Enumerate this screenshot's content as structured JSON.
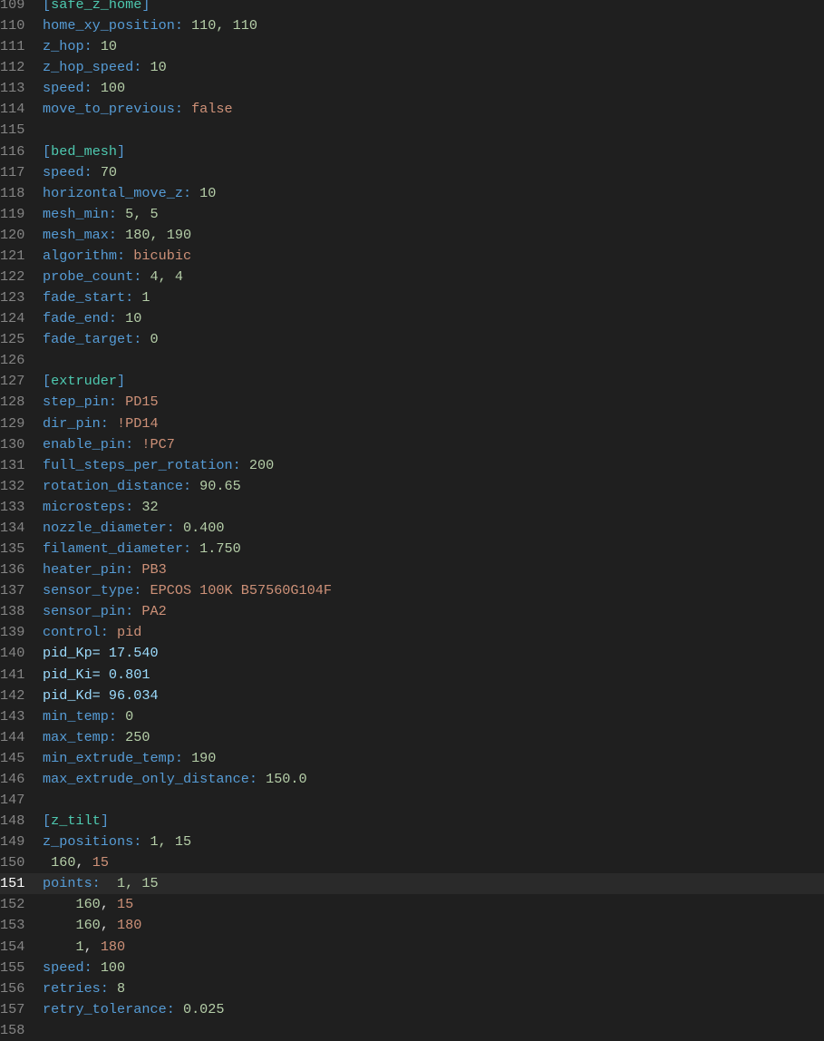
{
  "editor": {
    "current_line": 151,
    "lines": [
      {
        "n": 109,
        "tokens": [
          {
            "t": "[",
            "c": "b"
          },
          {
            "t": "safe_z_home",
            "c": "sec"
          },
          {
            "t": "]",
            "c": "b"
          }
        ]
      },
      {
        "n": 110,
        "tokens": [
          {
            "t": "home_xy_position: ",
            "c": "k"
          },
          {
            "t": "110, 110",
            "c": "n"
          }
        ]
      },
      {
        "n": 111,
        "tokens": [
          {
            "t": "z_hop: ",
            "c": "k"
          },
          {
            "t": "10",
            "c": "n"
          }
        ]
      },
      {
        "n": 112,
        "tokens": [
          {
            "t": "z_hop_speed: ",
            "c": "k"
          },
          {
            "t": "10",
            "c": "n"
          }
        ]
      },
      {
        "n": 113,
        "tokens": [
          {
            "t": "speed: ",
            "c": "k"
          },
          {
            "t": "100",
            "c": "n"
          }
        ]
      },
      {
        "n": 114,
        "tokens": [
          {
            "t": "move_to_previous: ",
            "c": "k"
          },
          {
            "t": "false",
            "c": "s"
          }
        ]
      },
      {
        "n": 115,
        "tokens": []
      },
      {
        "n": 116,
        "tokens": [
          {
            "t": "[",
            "c": "b"
          },
          {
            "t": "bed_mesh",
            "c": "sec"
          },
          {
            "t": "]",
            "c": "b"
          }
        ]
      },
      {
        "n": 117,
        "tokens": [
          {
            "t": "speed: ",
            "c": "k"
          },
          {
            "t": "70",
            "c": "n"
          }
        ]
      },
      {
        "n": 118,
        "tokens": [
          {
            "t": "horizontal_move_z: ",
            "c": "k"
          },
          {
            "t": "10",
            "c": "n"
          }
        ]
      },
      {
        "n": 119,
        "tokens": [
          {
            "t": "mesh_min: ",
            "c": "k"
          },
          {
            "t": "5, 5",
            "c": "n"
          }
        ]
      },
      {
        "n": 120,
        "tokens": [
          {
            "t": "mesh_max: ",
            "c": "k"
          },
          {
            "t": "180, 190",
            "c": "n"
          }
        ]
      },
      {
        "n": 121,
        "tokens": [
          {
            "t": "algorithm: ",
            "c": "k"
          },
          {
            "t": "bicubic",
            "c": "s"
          }
        ]
      },
      {
        "n": 122,
        "tokens": [
          {
            "t": "probe_count: ",
            "c": "k"
          },
          {
            "t": "4, 4",
            "c": "n"
          }
        ]
      },
      {
        "n": 123,
        "tokens": [
          {
            "t": "fade_start: ",
            "c": "k"
          },
          {
            "t": "1",
            "c": "n"
          }
        ]
      },
      {
        "n": 124,
        "tokens": [
          {
            "t": "fade_end: ",
            "c": "k"
          },
          {
            "t": "10",
            "c": "n"
          }
        ]
      },
      {
        "n": 125,
        "tokens": [
          {
            "t": "fade_target: ",
            "c": "k"
          },
          {
            "t": "0",
            "c": "n"
          }
        ]
      },
      {
        "n": 126,
        "tokens": []
      },
      {
        "n": 127,
        "tokens": [
          {
            "t": "[",
            "c": "b"
          },
          {
            "t": "extruder",
            "c": "sec"
          },
          {
            "t": "]",
            "c": "b"
          }
        ]
      },
      {
        "n": 128,
        "tokens": [
          {
            "t": "step_pin: ",
            "c": "k"
          },
          {
            "t": "PD15",
            "c": "s"
          }
        ]
      },
      {
        "n": 129,
        "tokens": [
          {
            "t": "dir_pin: ",
            "c": "k"
          },
          {
            "t": "!PD14",
            "c": "s"
          }
        ]
      },
      {
        "n": 130,
        "tokens": [
          {
            "t": "enable_pin: ",
            "c": "k"
          },
          {
            "t": "!PC7",
            "c": "s"
          }
        ]
      },
      {
        "n": 131,
        "tokens": [
          {
            "t": "full_steps_per_rotation: ",
            "c": "k"
          },
          {
            "t": "200",
            "c": "n"
          }
        ]
      },
      {
        "n": 132,
        "tokens": [
          {
            "t": "rotation_distance: ",
            "c": "k"
          },
          {
            "t": "90.65",
            "c": "n"
          }
        ]
      },
      {
        "n": 133,
        "tokens": [
          {
            "t": "microsteps: ",
            "c": "k"
          },
          {
            "t": "32",
            "c": "n"
          }
        ]
      },
      {
        "n": 134,
        "tokens": [
          {
            "t": "nozzle_diameter: ",
            "c": "k"
          },
          {
            "t": "0.400",
            "c": "n"
          }
        ]
      },
      {
        "n": 135,
        "tokens": [
          {
            "t": "filament_diameter: ",
            "c": "k"
          },
          {
            "t": "1.750",
            "c": "n"
          }
        ]
      },
      {
        "n": 136,
        "tokens": [
          {
            "t": "heater_pin: ",
            "c": "k"
          },
          {
            "t": "PB3",
            "c": "s"
          }
        ]
      },
      {
        "n": 137,
        "tokens": [
          {
            "t": "sensor_type: ",
            "c": "k"
          },
          {
            "t": "EPCOS 100K B57560G104F",
            "c": "s"
          }
        ]
      },
      {
        "n": 138,
        "tokens": [
          {
            "t": "sensor_pin: ",
            "c": "k"
          },
          {
            "t": "PA2",
            "c": "s"
          }
        ]
      },
      {
        "n": 139,
        "tokens": [
          {
            "t": "control: ",
            "c": "k"
          },
          {
            "t": "pid",
            "c": "s"
          }
        ]
      },
      {
        "n": 140,
        "tokens": [
          {
            "t": "pid_Kp= 17.540",
            "c": "v"
          }
        ]
      },
      {
        "n": 141,
        "tokens": [
          {
            "t": "pid_Ki= 0.801",
            "c": "v"
          }
        ]
      },
      {
        "n": 142,
        "tokens": [
          {
            "t": "pid_Kd= 96.034",
            "c": "v"
          }
        ]
      },
      {
        "n": 143,
        "tokens": [
          {
            "t": "min_temp: ",
            "c": "k"
          },
          {
            "t": "0",
            "c": "n"
          }
        ]
      },
      {
        "n": 144,
        "tokens": [
          {
            "t": "max_temp: ",
            "c": "k"
          },
          {
            "t": "250",
            "c": "n"
          }
        ]
      },
      {
        "n": 145,
        "tokens": [
          {
            "t": "min_extrude_temp: ",
            "c": "k"
          },
          {
            "t": "190",
            "c": "n"
          }
        ]
      },
      {
        "n": 146,
        "tokens": [
          {
            "t": "max_extrude_only_distance: ",
            "c": "k"
          },
          {
            "t": "150.0",
            "c": "n"
          }
        ]
      },
      {
        "n": 147,
        "tokens": []
      },
      {
        "n": 148,
        "tokens": [
          {
            "t": "[",
            "c": "b"
          },
          {
            "t": "z_tilt",
            "c": "sec"
          },
          {
            "t": "]",
            "c": "b"
          }
        ]
      },
      {
        "n": 149,
        "tokens": [
          {
            "t": "z_positions: ",
            "c": "k"
          },
          {
            "t": "1, 15",
            "c": "n"
          }
        ]
      },
      {
        "n": 150,
        "tokens": [
          {
            "t": " 160",
            "c": "n"
          },
          {
            "t": ", ",
            "c": "p"
          },
          {
            "t": "15",
            "c": "s"
          }
        ]
      },
      {
        "n": 151,
        "tokens": [
          {
            "t": "points: ",
            "c": "k"
          },
          {
            "t": " 1, 15",
            "c": "n"
          }
        ]
      },
      {
        "n": 152,
        "tokens": [
          {
            "t": "    160",
            "c": "n"
          },
          {
            "t": ", ",
            "c": "p"
          },
          {
            "t": "15",
            "c": "s"
          }
        ]
      },
      {
        "n": 153,
        "tokens": [
          {
            "t": "    160",
            "c": "n"
          },
          {
            "t": ", ",
            "c": "p"
          },
          {
            "t": "180",
            "c": "s"
          }
        ]
      },
      {
        "n": 154,
        "tokens": [
          {
            "t": "    1",
            "c": "n"
          },
          {
            "t": ", ",
            "c": "p"
          },
          {
            "t": "180",
            "c": "s"
          }
        ]
      },
      {
        "n": 155,
        "tokens": [
          {
            "t": "speed: ",
            "c": "k"
          },
          {
            "t": "100",
            "c": "n"
          }
        ]
      },
      {
        "n": 156,
        "tokens": [
          {
            "t": "retries: ",
            "c": "k"
          },
          {
            "t": "8",
            "c": "n"
          }
        ]
      },
      {
        "n": 157,
        "tokens": [
          {
            "t": "retry_tolerance: ",
            "c": "k"
          },
          {
            "t": "0.025",
            "c": "n"
          }
        ]
      },
      {
        "n": 158,
        "tokens": []
      }
    ]
  }
}
